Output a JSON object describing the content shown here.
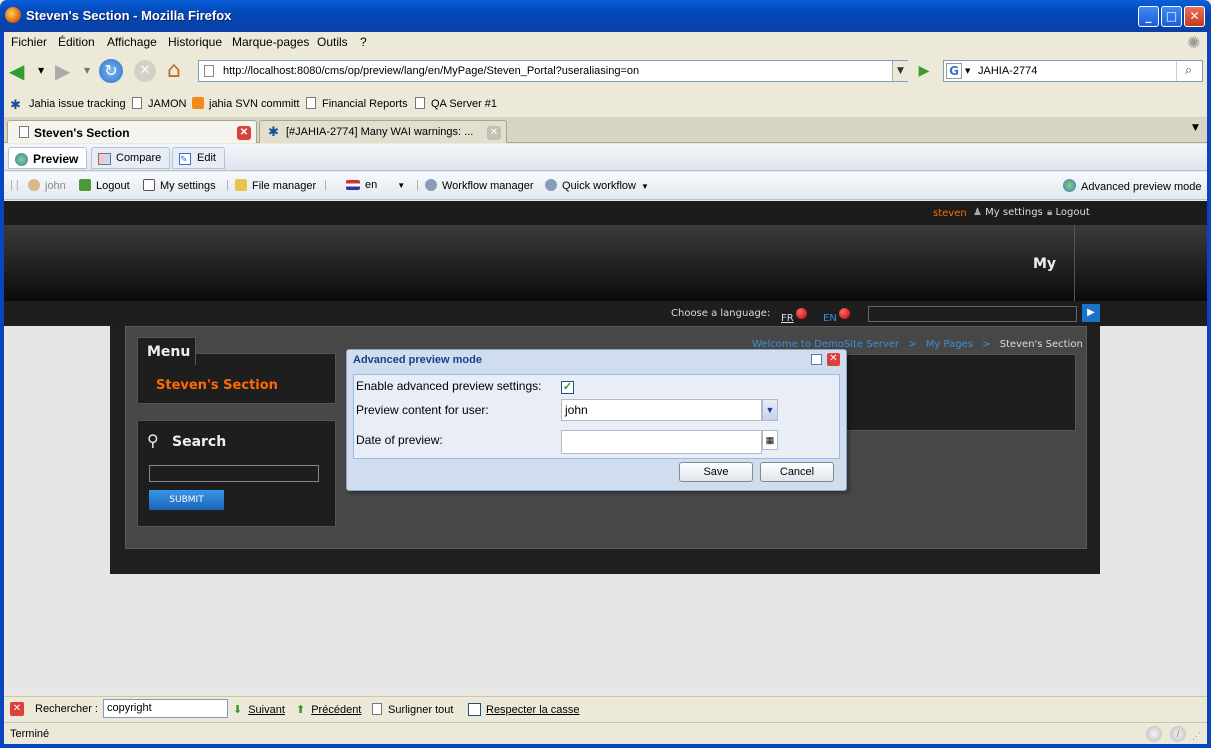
{
  "window": {
    "title": "Steven's Section - Mozilla Firefox"
  },
  "menu": [
    "Fichier",
    "Édition",
    "Affichage",
    "Historique",
    "Marque-pages",
    "Outils",
    "?"
  ],
  "nav": {
    "url": "http://localhost:8080/cms/op/preview/lang/en/MyPage/Steven_Portal?useraliasing=on",
    "search_value": "JAHIA-2774"
  },
  "bookmarks": [
    "Jahia issue tracking",
    "JAMON",
    "jahia SVN committ",
    "Financial Reports",
    "QA Server #1"
  ],
  "tabs": [
    {
      "label": "Steven's Section"
    },
    {
      "label": "[#JAHIA-2774] Many WAI warnings: ..."
    }
  ],
  "jahia_modes": [
    "Preview",
    "Compare",
    "Edit"
  ],
  "jahia_toolbar": {
    "user": "john",
    "logout": "Logout",
    "my_settings": "My settings",
    "file_manager": "File manager",
    "language": "en",
    "workflow_manager": "Workflow manager",
    "quick_workflow": "Quick workflow",
    "advanced_preview": "Advanced preview mode"
  },
  "site": {
    "top_user": "steven",
    "top_settings": "My settings",
    "top_logout": "Logout",
    "banner_text": "My",
    "choose_language": "Choose a language:",
    "lang_fr": "FR",
    "lang_en": "EN",
    "breadcrumb": [
      "Welcome to DemoSite Server",
      "My Pages",
      "Steven's Section"
    ],
    "breadcrumb_sep": ">",
    "menu_title": "Menu",
    "menu_item": "Steven's Section",
    "search_title": "Search",
    "submit_label": "SUBMIT"
  },
  "dialog": {
    "title": "Advanced preview mode",
    "enable_label": "Enable advanced preview settings:",
    "enable_checked": true,
    "user_label": "Preview content for user:",
    "user_value": "john",
    "date_label": "Date of preview:",
    "date_value": "",
    "save": "Save",
    "cancel": "Cancel"
  },
  "findbar": {
    "label": "Rechercher :",
    "value": "copyright",
    "next": "Suivant",
    "prev": "Précédent",
    "highlight": "Surligner tout",
    "match_case": "Respecter la casse"
  },
  "status": {
    "text": "Terminé"
  },
  "colors": {
    "xp_blue": "#0a45c0",
    "accent_orange": "#ff6a00",
    "link_blue": "#3b8fd8",
    "submit_blue": "#1a73c9"
  }
}
